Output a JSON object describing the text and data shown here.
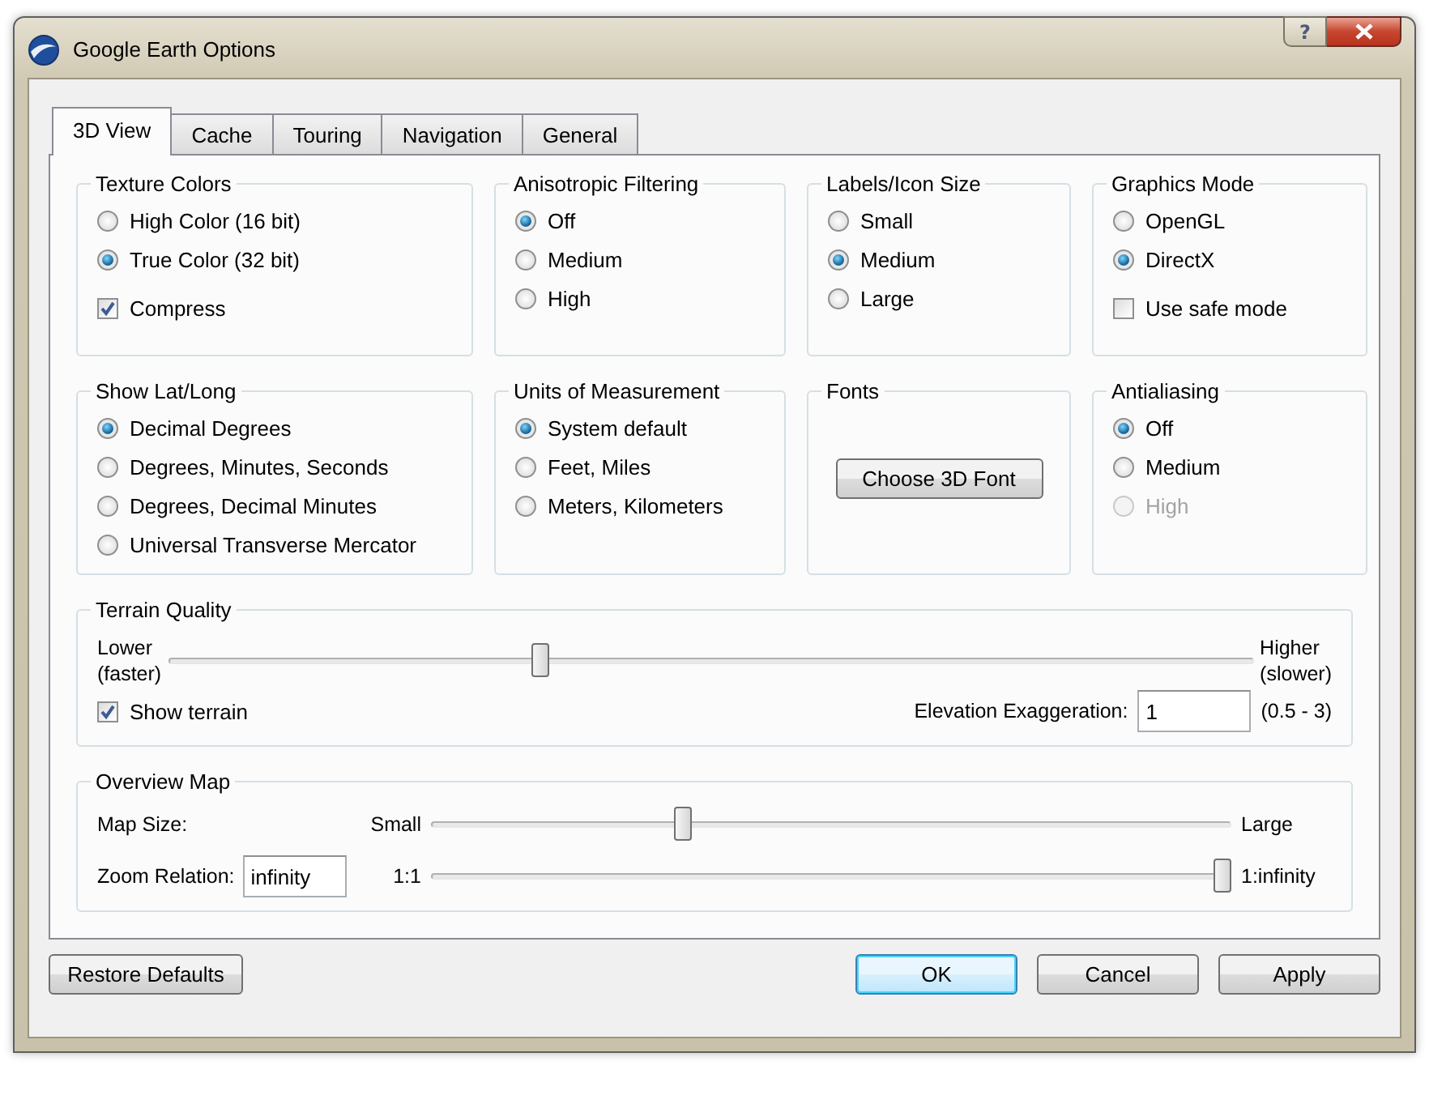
{
  "window": {
    "title": "Google Earth Options",
    "help_label": "?"
  },
  "tabs": [
    {
      "label": "3D View",
      "selected": true
    },
    {
      "label": "Cache",
      "selected": false
    },
    {
      "label": "Touring",
      "selected": false
    },
    {
      "label": "Navigation",
      "selected": false
    },
    {
      "label": "General",
      "selected": false
    }
  ],
  "groups": [
    {
      "title": "Texture Colors",
      "items": [
        {
          "kind": "radio",
          "label": "High Color (16 bit)",
          "selected": false,
          "disabled": false
        },
        {
          "kind": "radio",
          "label": "True Color (32 bit)",
          "selected": true,
          "disabled": false
        },
        {
          "kind": "checkbox",
          "label": "Compress",
          "checked": true,
          "disabled": false
        }
      ]
    },
    {
      "title": "Anisotropic Filtering",
      "items": [
        {
          "kind": "radio",
          "label": "Off",
          "selected": true,
          "disabled": false
        },
        {
          "kind": "radio",
          "label": "Medium",
          "selected": false,
          "disabled": false
        },
        {
          "kind": "radio",
          "label": "High",
          "selected": false,
          "disabled": false
        }
      ]
    },
    {
      "title": "Labels/Icon Size",
      "items": [
        {
          "kind": "radio",
          "label": "Small",
          "selected": false,
          "disabled": false
        },
        {
          "kind": "radio",
          "label": "Medium",
          "selected": true,
          "disabled": false
        },
        {
          "kind": "radio",
          "label": "Large",
          "selected": false,
          "disabled": false
        }
      ]
    },
    {
      "title": "Graphics Mode",
      "items": [
        {
          "kind": "radio",
          "label": "OpenGL",
          "selected": false,
          "disabled": false
        },
        {
          "kind": "radio",
          "label": "DirectX",
          "selected": true,
          "disabled": false
        },
        {
          "kind": "checkbox",
          "label": "Use safe mode",
          "checked": false,
          "disabled": false
        }
      ]
    },
    {
      "title": "Show Lat/Long",
      "items": [
        {
          "kind": "radio",
          "label": "Decimal Degrees",
          "selected": true,
          "disabled": false
        },
        {
          "kind": "radio",
          "label": "Degrees, Minutes, Seconds",
          "selected": false,
          "disabled": false
        },
        {
          "kind": "radio",
          "label": "Degrees, Decimal Minutes",
          "selected": false,
          "disabled": false
        },
        {
          "kind": "radio",
          "label": "Universal Transverse Mercator",
          "selected": false,
          "disabled": false
        }
      ]
    },
    {
      "title": "Units of Measurement",
      "items": [
        {
          "kind": "radio",
          "label": "System default",
          "selected": true,
          "disabled": false
        },
        {
          "kind": "radio",
          "label": "Feet, Miles",
          "selected": false,
          "disabled": false
        },
        {
          "kind": "radio",
          "label": "Meters, Kilometers",
          "selected": false,
          "disabled": false
        }
      ]
    },
    {
      "title": "Fonts",
      "items": [
        {
          "kind": "button",
          "label": "Choose 3D Font"
        }
      ]
    },
    {
      "title": "Antialiasing",
      "items": [
        {
          "kind": "radio",
          "label": "Off",
          "selected": true,
          "disabled": false
        },
        {
          "kind": "radio",
          "label": "Medium",
          "selected": false,
          "disabled": false
        },
        {
          "kind": "radio",
          "label": "High",
          "selected": false,
          "disabled": true
        }
      ]
    }
  ],
  "terrain_quality": {
    "title": "Terrain Quality",
    "min_label": "Lower",
    "min_note": "(faster)",
    "max_label": "Higher",
    "max_note": "(slower)",
    "level": 0.34,
    "show_terrain": {
      "label": "Show terrain",
      "checked": true
    },
    "elevation": {
      "label": "Elevation Exaggeration:",
      "value": "1",
      "range": "(0.5 - 3)"
    }
  },
  "overview_map": {
    "title": "Overview Map",
    "map_size": {
      "label": "Map Size:",
      "min_label": "Small",
      "max_label": "Large",
      "level": 0.31
    },
    "zoom_relation": {
      "label": "Zoom Relation:",
      "value": "infinity",
      "min_label": "1:1",
      "max_label": "1:infinity",
      "level": 1
    }
  },
  "buttons": [
    {
      "label": "Restore Defaults",
      "default": false
    },
    {
      "label": "OK",
      "default": true
    },
    {
      "label": "Cancel",
      "default": false
    },
    {
      "label": "Apply",
      "default": false
    }
  ]
}
